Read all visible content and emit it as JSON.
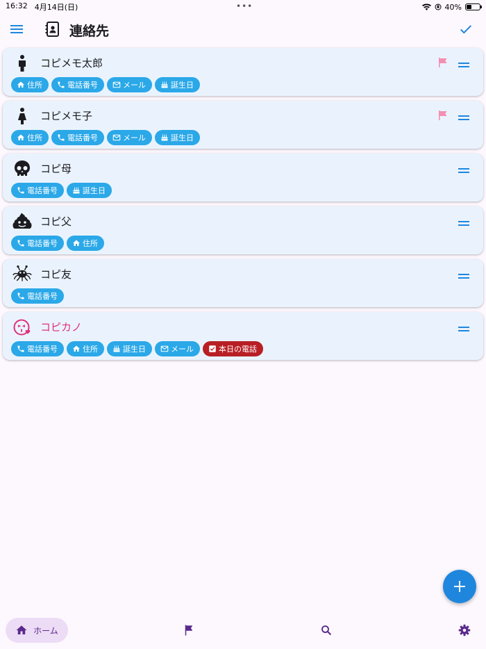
{
  "status": {
    "time": "16:32",
    "date": "4月14日(日)",
    "battery": "40%",
    "battery_level": 0.4
  },
  "header": {
    "title": "連絡先"
  },
  "contacts": [
    {
      "name": "コピメモ太郎",
      "icon": "person-icon",
      "flag": true,
      "chips": [
        {
          "label": "住所",
          "icon": "home-icon"
        },
        {
          "label": "電話番号",
          "icon": "phone-icon"
        },
        {
          "label": "メール",
          "icon": "mail-icon"
        },
        {
          "label": "誕生日",
          "icon": "cake-icon"
        }
      ]
    },
    {
      "name": "コピメモ子",
      "icon": "person-dress-icon",
      "flag": true,
      "chips": [
        {
          "label": "住所",
          "icon": "home-icon"
        },
        {
          "label": "電話番号",
          "icon": "phone-icon"
        },
        {
          "label": "メール",
          "icon": "mail-icon"
        },
        {
          "label": "誕生日",
          "icon": "cake-icon"
        }
      ]
    },
    {
      "name": "コピ母",
      "icon": "skull-icon",
      "flag": false,
      "chips": [
        {
          "label": "電話番号",
          "icon": "phone-icon"
        },
        {
          "label": "誕生日",
          "icon": "cake-icon"
        }
      ]
    },
    {
      "name": "コピ父",
      "icon": "poop-icon",
      "flag": false,
      "chips": [
        {
          "label": "電話番号",
          "icon": "phone-icon"
        },
        {
          "label": "住所",
          "icon": "home-icon"
        }
      ]
    },
    {
      "name": "コピ友",
      "icon": "spaghetti-monster-icon",
      "flag": false,
      "chips": [
        {
          "label": "電話番号",
          "icon": "phone-icon"
        }
      ]
    },
    {
      "name": "コピカノ",
      "icon": "kiss-face-icon",
      "flag": false,
      "highlight": true,
      "chips": [
        {
          "label": "電話番号",
          "icon": "phone-icon"
        },
        {
          "label": "住所",
          "icon": "home-icon"
        },
        {
          "label": "誕生日",
          "icon": "cake-icon"
        },
        {
          "label": "メール",
          "icon": "mail-icon"
        },
        {
          "label": "本日の電話",
          "icon": "checkbox-icon",
          "alert": true
        }
      ]
    }
  ],
  "nav": {
    "home_label": "ホーム"
  },
  "colors": {
    "chip": "#2ba8e8",
    "alert_chip": "#b81f25",
    "flag": "#f48fb1",
    "accent": "#1f86de",
    "pink_name": "#e0307a"
  }
}
